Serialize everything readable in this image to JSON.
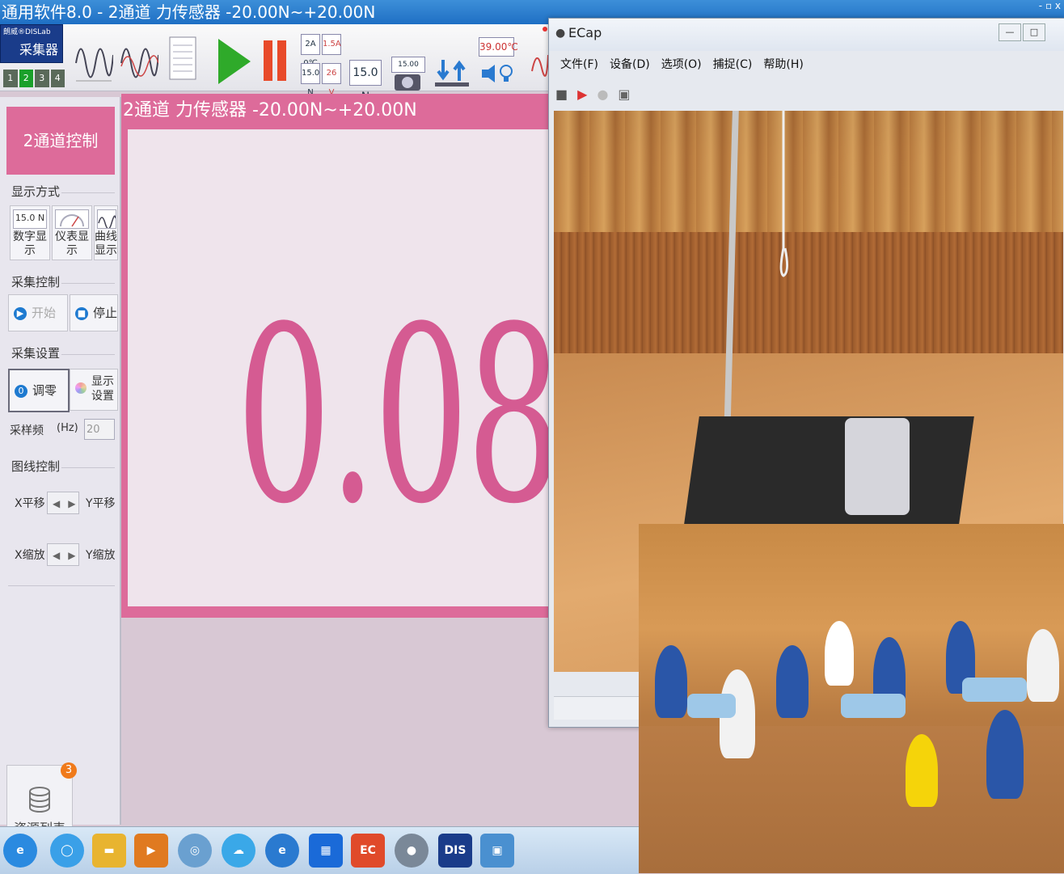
{
  "app": {
    "title": "通用软件8.0 - 2通道 力传感器 -20.00N~+20.00N",
    "window_controls": "- ▫ x"
  },
  "toolbar": {
    "collector_brand": "朗威®DISLab",
    "collector_name": "采集器",
    "channels": [
      "1",
      "2",
      "3",
      "4"
    ],
    "active_channel": "2",
    "mini_readouts": {
      "multi_a": "2A 0℃",
      "multi_b": "1.5A",
      "multi_c": "15.0 N",
      "multi_d": "26 V",
      "digital": "15.0 N",
      "camera": "15.00",
      "meter_top": "39.00℃"
    }
  },
  "left_panel": {
    "channel_control": "2通道控制",
    "display_mode_label": "显示方式",
    "display_buttons": [
      {
        "icon_text": "15.0 N",
        "label": "数字显示"
      },
      {
        "icon_text": "",
        "label": "仪表显示"
      },
      {
        "icon_text": "",
        "label": "曲线显示"
      }
    ],
    "acq_control_label": "采集控制",
    "start_label": "开始",
    "stop_label": "停止",
    "acq_settings_label": "采集设置",
    "zero_label": "调零",
    "zero_icon": "0",
    "display_settings_label": "显示设置",
    "sample_rate_label": "采样频",
    "sample_rate_unit": "(Hz)",
    "sample_rate_value": "20",
    "graph_control_label": "图线控制",
    "x_pan": "X平移",
    "y_pan": "Y平移",
    "x_zoom": "X缩放",
    "y_zoom": "Y缩放",
    "resource_label": "资源列表",
    "resource_badge": "3"
  },
  "display": {
    "title": "2通道 力传感器 -20.00N~+20.00N",
    "reading": "0.08"
  },
  "ecap": {
    "title": "ECap",
    "menu": [
      "文件(F)",
      "设备(D)",
      "选项(O)",
      "捕捉(C)",
      "帮助(H)"
    ]
  },
  "taskbar": {
    "icons": [
      "ie-icon",
      "folder-icon",
      "media-icon",
      "camera-icon",
      "cloud-icon",
      "browser-icon",
      "grid-icon",
      "ec-icon",
      "webcam-icon",
      "dis-icon",
      "app-icon"
    ],
    "dis_text": "DIS",
    "ec_text": "EC"
  },
  "colors": {
    "accent_pink": "#dd6b9a",
    "reading_pink": "#d55b92",
    "titlebar_blue": "#1e6fc4"
  }
}
